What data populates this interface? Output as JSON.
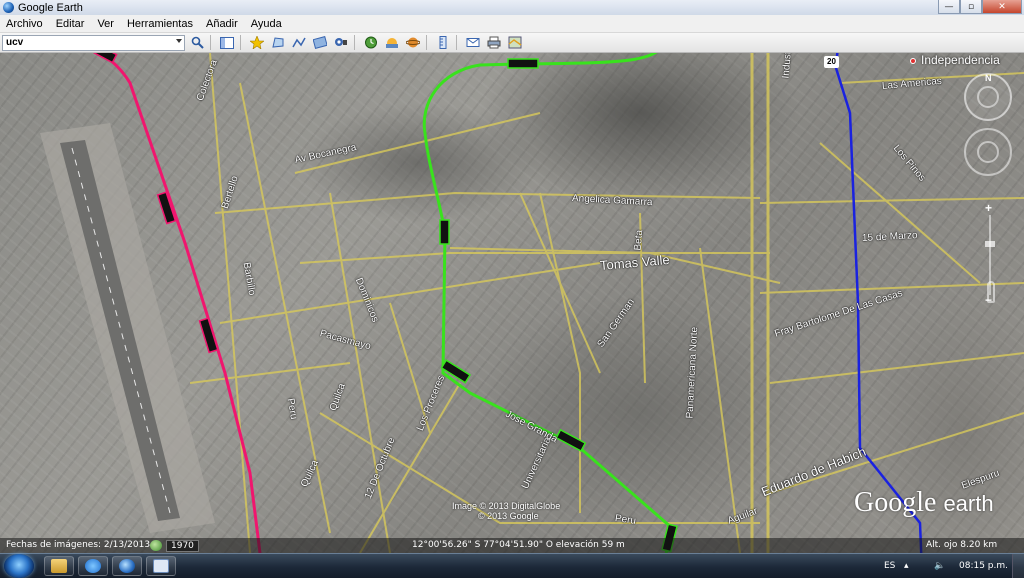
{
  "window": {
    "title": "Google Earth",
    "minimize_glyph": "—",
    "maximize_glyph": "▫",
    "close_glyph": "✕"
  },
  "menu": [
    "Archivo",
    "Editar",
    "Ver",
    "Herramientas",
    "Añadir",
    "Ayuda"
  ],
  "search": {
    "value": "ucv",
    "button_icon": "magnifier-icon"
  },
  "toolbar_icons": [
    "sidebar-toggle-icon",
    "placemark-icon",
    "polygon-icon",
    "path-icon",
    "image-overlay-icon",
    "record-tour-icon",
    "historical-imagery-icon",
    "sunlight-icon",
    "planets-icon",
    "ruler-icon",
    "email-icon",
    "print-icon",
    "view-in-maps-icon"
  ],
  "map": {
    "labels": {
      "colectora": "Colectora",
      "av_bocanegra": "Av Bocanegra",
      "angelica_gamarra": "Angelica Gamarra",
      "tomas_valle": "Tomas Valle",
      "beta": "Beta",
      "san_german": "San German",
      "bertello": "Bertello",
      "barbillo": "Barbillo",
      "dominicos": "Dominicos",
      "pacasmayo": "Pacasmayo",
      "peru_left": "Peru",
      "quilca_top": "Quilca",
      "quilca_bottom": "Quilca",
      "los_proceres": "Los Proceres",
      "doce_octubre": "12 De Octubre",
      "universitaria": "Universitaria",
      "jose_granda": "Jose Granda",
      "peru_bottom": "Peru",
      "aguilar": "Aguilar",
      "panamericana": "Panamericana Norte",
      "industrial": "Industrial",
      "las_americas": "Las Americas",
      "los_pinos": "Los Pinos",
      "quince_marzo": "15 de Marzo",
      "fray_bartolome": "Fray Bartolome De Las Casas",
      "eduardo_habich": "Eduardo de Habich",
      "elespuru": "Elespuru",
      "place": "Independencia",
      "highway_shield": "20"
    },
    "copyright_lines": [
      "Image © 2013 DigitalGlobe",
      "© 2013 Google"
    ],
    "logo": {
      "google": "Google",
      "earth": "earth"
    },
    "routes": {
      "pink": "#f0166e",
      "green": "#39e21d",
      "blue": "#1a22e0",
      "station_fill": "#111111"
    },
    "compass_north": "N"
  },
  "status": {
    "imagery_date": "Fechas de imágenes: 2/13/2013",
    "year": "1970",
    "coordinates": "12°00'56.26\" S  77°04'51.90\" O  elevación   59 m",
    "eye_alt": "Alt. ojo    8.20 km"
  },
  "taskbar": {
    "apps": [
      "windows-explorer-icon",
      "internet-explorer-icon",
      "google-earth-icon",
      "window-icon"
    ],
    "language": "ES",
    "time": "08:15 p.m."
  }
}
